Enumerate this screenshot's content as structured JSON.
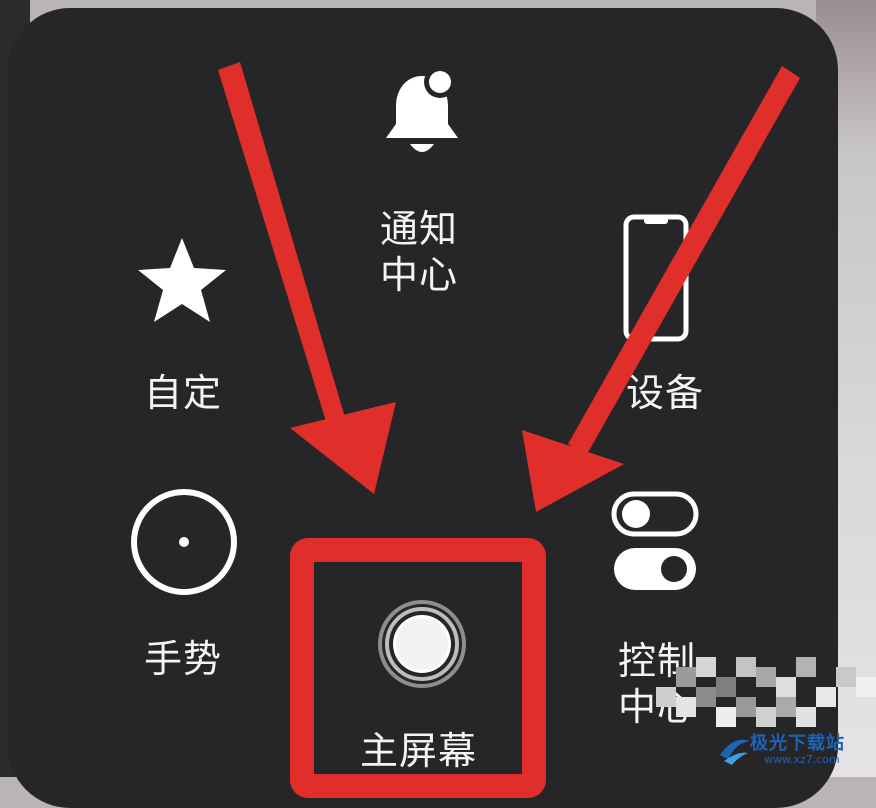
{
  "menu": {
    "notification_center": {
      "label": "通知中心",
      "icon": "bell-icon"
    },
    "custom": {
      "label": "自定",
      "icon": "star-icon"
    },
    "device": {
      "label": "设备",
      "icon": "phone-icon"
    },
    "gestures": {
      "label": "手势",
      "icon": "gesture-circle-icon"
    },
    "home": {
      "label": "主屏幕",
      "icon": "home-button-icon"
    },
    "control_center": {
      "label": "控制中心",
      "icon": "toggles-icon"
    }
  },
  "annotation": {
    "highlight_color": "#e02f2a",
    "target": "home"
  },
  "watermark": {
    "name": "极光下载站",
    "url": "www.xz7.com"
  },
  "colors": {
    "panel": "#262628",
    "text": "#f4f4f4",
    "arrow": "#e02f2a"
  }
}
